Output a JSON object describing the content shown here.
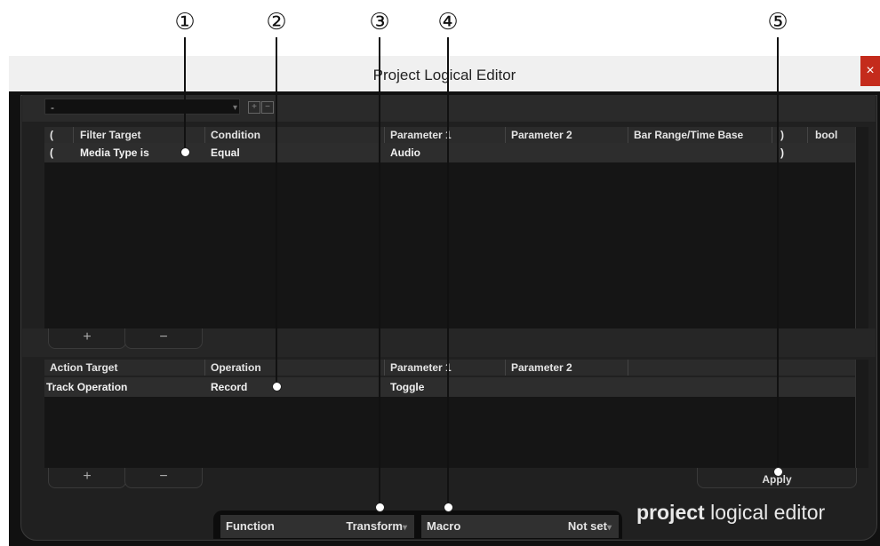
{
  "callouts": [
    "①",
    "②",
    "③",
    "④",
    "⑤"
  ],
  "window": {
    "title": "Project Logical Editor",
    "close_glyph": "×"
  },
  "preset": {
    "value": "-",
    "caret": "▾",
    "add_glyph": "+",
    "remove_glyph": "−"
  },
  "filter": {
    "columns": [
      "(",
      "Filter Target",
      "Condition",
      "Parameter 1",
      "Parameter 2",
      "Bar Range/Time Base",
      ")",
      "bool"
    ],
    "row": {
      "open_paren": "(",
      "target": "Media Type is",
      "condition": "Equal",
      "param1": "Audio",
      "close_paren": ")"
    },
    "add_label": "+",
    "remove_label": "−"
  },
  "action": {
    "columns": [
      "Action Target",
      "Operation",
      "Parameter 1",
      "Parameter 2"
    ],
    "row": {
      "target": "Track Operation",
      "operation": "Record",
      "param1": "Toggle"
    },
    "add_label": "+",
    "remove_label": "−",
    "apply_label": "Apply"
  },
  "footer": {
    "function_label": "Function",
    "function_value": "Transform",
    "macro_label": "Macro",
    "macro_value": "Not set",
    "dropdown_caret": "▾",
    "brand_bold": "project",
    "brand_light": " logical editor"
  },
  "colors": {
    "accent_close": "#c42b1c",
    "panel": "#202020"
  }
}
